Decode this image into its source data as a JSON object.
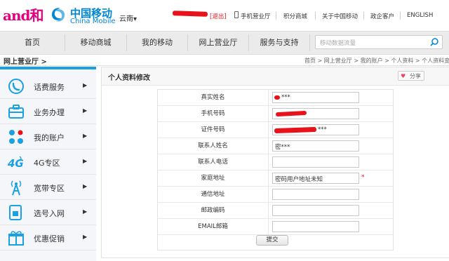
{
  "header": {
    "brand_and": "and",
    "brand_he": "和",
    "brand_cn": "中国移动",
    "brand_en": "China Mobile",
    "region": "云南",
    "logout": "[退出]",
    "links": [
      "手机营业厅",
      "积分商城",
      "关于中国移动",
      "政企客户",
      "ENGLISH"
    ]
  },
  "nav": {
    "items": [
      "首页",
      "移动商城",
      "我的移动",
      "网上营业厅",
      "服务与支持"
    ],
    "search_placeholder": "移动数据流量"
  },
  "breadcrumb": {
    "section": "网上营业厅 >",
    "path": "首页 > 网上营业厅 > 我的账户 > 个人资料 > 个人资料变更"
  },
  "sidebar": {
    "items": [
      {
        "label": "话费服务",
        "icon": "phone-fee-icon"
      },
      {
        "label": "业务办理",
        "icon": "briefcase-icon"
      },
      {
        "label": "我的账户",
        "icon": "account-icon"
      },
      {
        "label": "4G专区",
        "icon": "4g-icon"
      },
      {
        "label": "宽带专区",
        "icon": "broadband-icon"
      },
      {
        "label": "选号入网",
        "icon": "sim-card-icon"
      },
      {
        "label": "优惠促销",
        "icon": "gift-icon"
      }
    ],
    "arrow": "▶"
  },
  "panel": {
    "title": "个人资料修改",
    "share": "分享"
  },
  "form": {
    "rows": [
      {
        "label": "真实姓名",
        "value": "***"
      },
      {
        "label": "手机号码",
        "value": ""
      },
      {
        "label": "证件号码",
        "value": "***"
      },
      {
        "label": "联系人姓名",
        "value": "密***"
      },
      {
        "label": "联系人电话",
        "value": ""
      },
      {
        "label": "家庭地址",
        "value": "密码用户地址未知",
        "required": "*"
      },
      {
        "label": "通信地址",
        "value": ""
      },
      {
        "label": "邮政编码",
        "value": ""
      },
      {
        "label": "EMAIL邮箱",
        "value": ""
      }
    ],
    "submit": "提交"
  },
  "colors": {
    "brand_pink": "#e4007f",
    "brand_blue": "#0085d0",
    "accent_blue": "#1aa1e3",
    "redaction_red": "#e8121a"
  }
}
